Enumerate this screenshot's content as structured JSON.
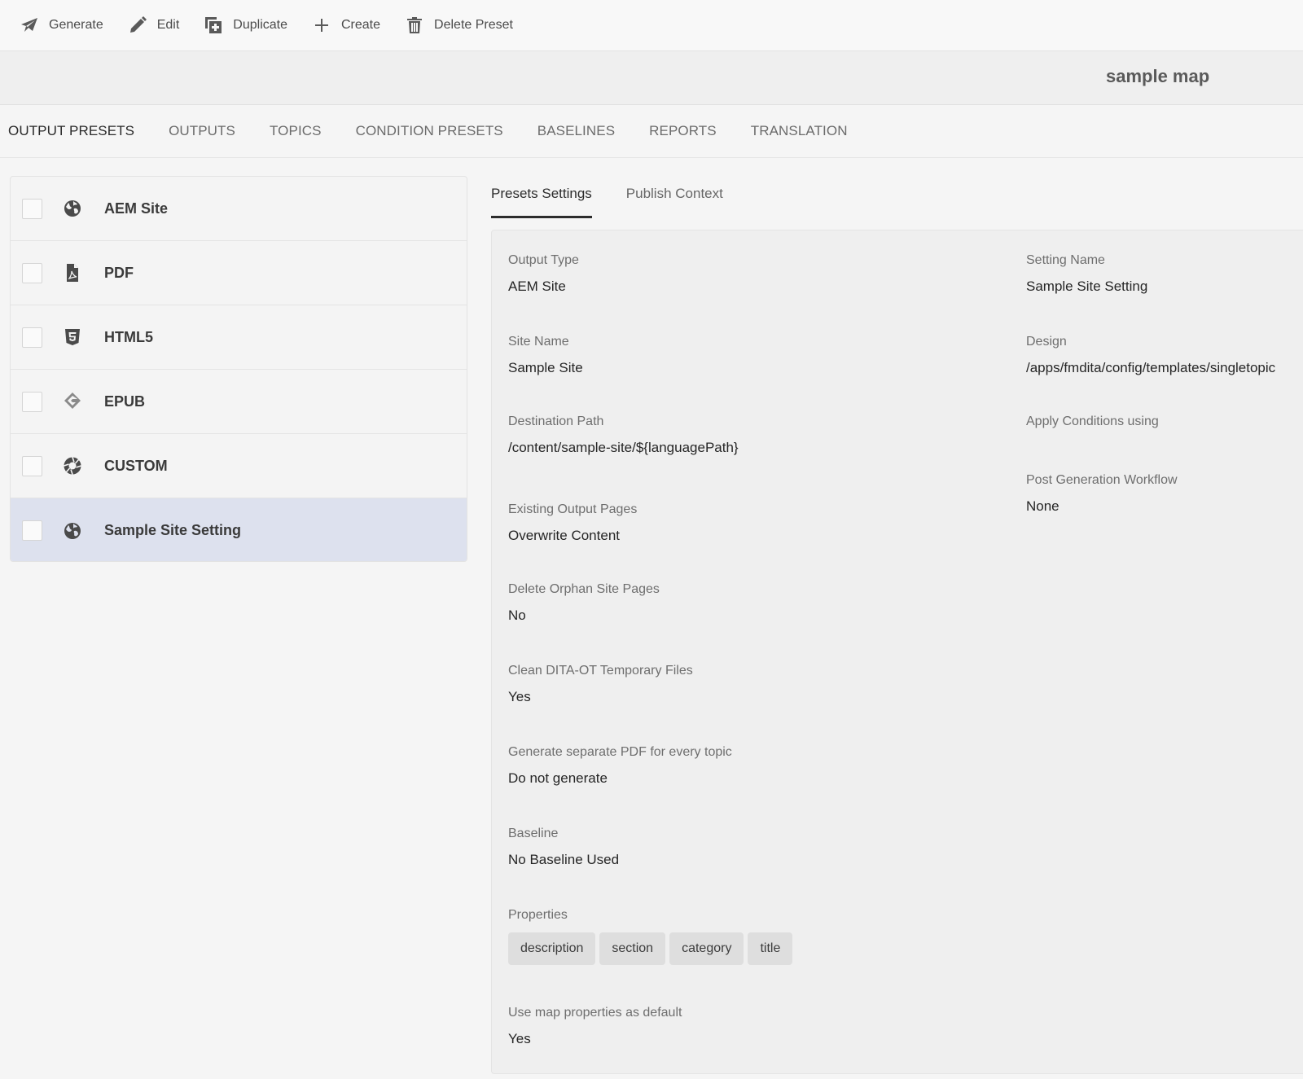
{
  "toolbar": {
    "items": [
      {
        "label": "Generate",
        "icon": "paper-plane-icon"
      },
      {
        "label": "Edit",
        "icon": "pencil-icon"
      },
      {
        "label": "Duplicate",
        "icon": "duplicate-icon"
      },
      {
        "label": "Create",
        "icon": "plus-icon"
      },
      {
        "label": "Delete Preset",
        "icon": "trash-icon"
      }
    ]
  },
  "header": {
    "map_title": "sample map"
  },
  "main_tabs": [
    {
      "label": "OUTPUT PRESETS",
      "active": true
    },
    {
      "label": "OUTPUTS"
    },
    {
      "label": "TOPICS"
    },
    {
      "label": "CONDITION PRESETS"
    },
    {
      "label": "BASELINES"
    },
    {
      "label": "REPORTS"
    },
    {
      "label": "TRANSLATION"
    }
  ],
  "presets": [
    {
      "label": "AEM Site",
      "icon": "globe-icon"
    },
    {
      "label": "PDF",
      "icon": "pdf-icon"
    },
    {
      "label": "HTML5",
      "icon": "html5-icon"
    },
    {
      "label": "EPUB",
      "icon": "epub-icon"
    },
    {
      "label": "CUSTOM",
      "icon": "aperture-icon"
    },
    {
      "label": "Sample Site Setting",
      "icon": "globe-icon",
      "selected": true
    }
  ],
  "sub_tabs": [
    {
      "label": "Presets Settings",
      "active": true
    },
    {
      "label": "Publish Context"
    }
  ],
  "settings": {
    "output_type": {
      "label": "Output Type",
      "value": "AEM Site"
    },
    "site_name": {
      "label": "Site Name",
      "value": "Sample Site"
    },
    "destination_path": {
      "label": "Destination Path",
      "value": "/content/sample-site/${languagePath}"
    },
    "existing_output_pages": {
      "label": "Existing Output Pages",
      "value": "Overwrite Content"
    },
    "delete_orphan": {
      "label": "Delete Orphan Site Pages",
      "value": "No"
    },
    "clean_temp": {
      "label": "Clean DITA-OT Temporary Files",
      "value": "Yes"
    },
    "separate_pdf": {
      "label": "Generate separate PDF for every topic",
      "value": "Do not generate"
    },
    "baseline": {
      "label": "Baseline",
      "value": "No Baseline Used"
    },
    "properties": {
      "label": "Properties",
      "tags": [
        "description",
        "section",
        "category",
        "title"
      ]
    },
    "use_map_props": {
      "label": "Use map properties as default",
      "value": "Yes"
    },
    "setting_name": {
      "label": "Setting Name",
      "value": "Sample Site Setting"
    },
    "design": {
      "label": "Design",
      "value": "/apps/fmdita/config/templates/singletopic"
    },
    "apply_conditions": {
      "label": "Apply Conditions using",
      "value": ""
    },
    "post_gen_workflow": {
      "label": "Post Generation Workflow",
      "value": "None"
    }
  }
}
